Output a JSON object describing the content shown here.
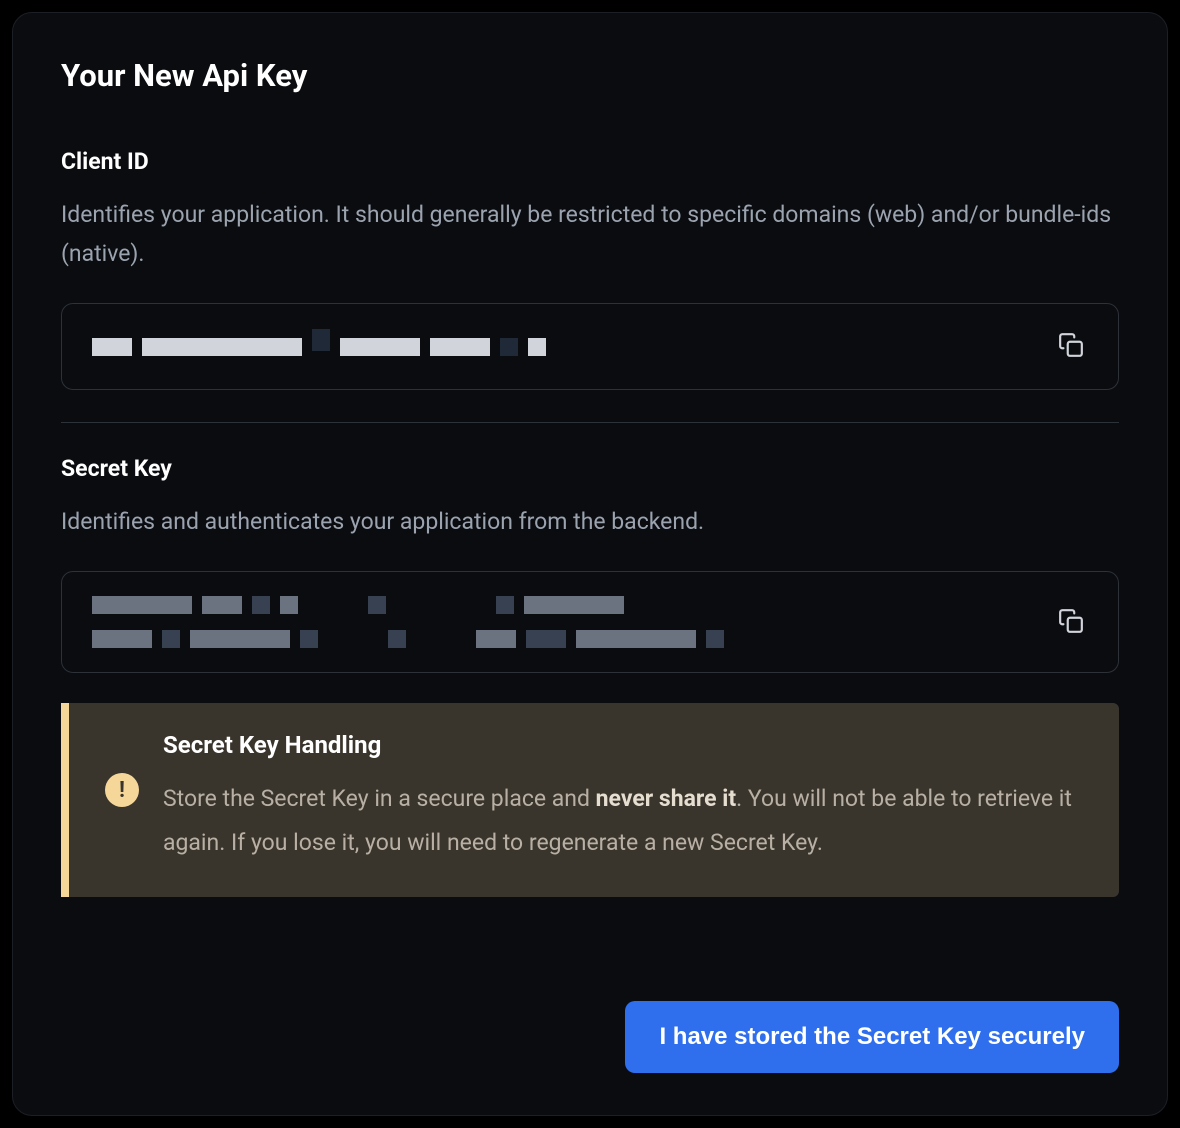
{
  "modal": {
    "title": "Your New Api Key"
  },
  "client_id": {
    "title": "Client ID",
    "description": "Identifies your application. It should generally be restricted to specific domains (web) and/or bundle-ids (native).",
    "value": "[REDACTED - pixelated content]"
  },
  "secret_key": {
    "title": "Secret Key",
    "description": "Identifies and authenticates your application from the backend.",
    "value": "[REDACTED - pixelated content]"
  },
  "warning": {
    "title": "Secret Key Handling",
    "text_part1": "Store the Secret Key in a secure place and ",
    "text_bold": "never share it",
    "text_part2": ". You will not be able to retrieve it again. If you lose it, you will need to regenerate a new Secret Key."
  },
  "footer": {
    "confirm_label": "I have stored the Secret Key securely"
  }
}
